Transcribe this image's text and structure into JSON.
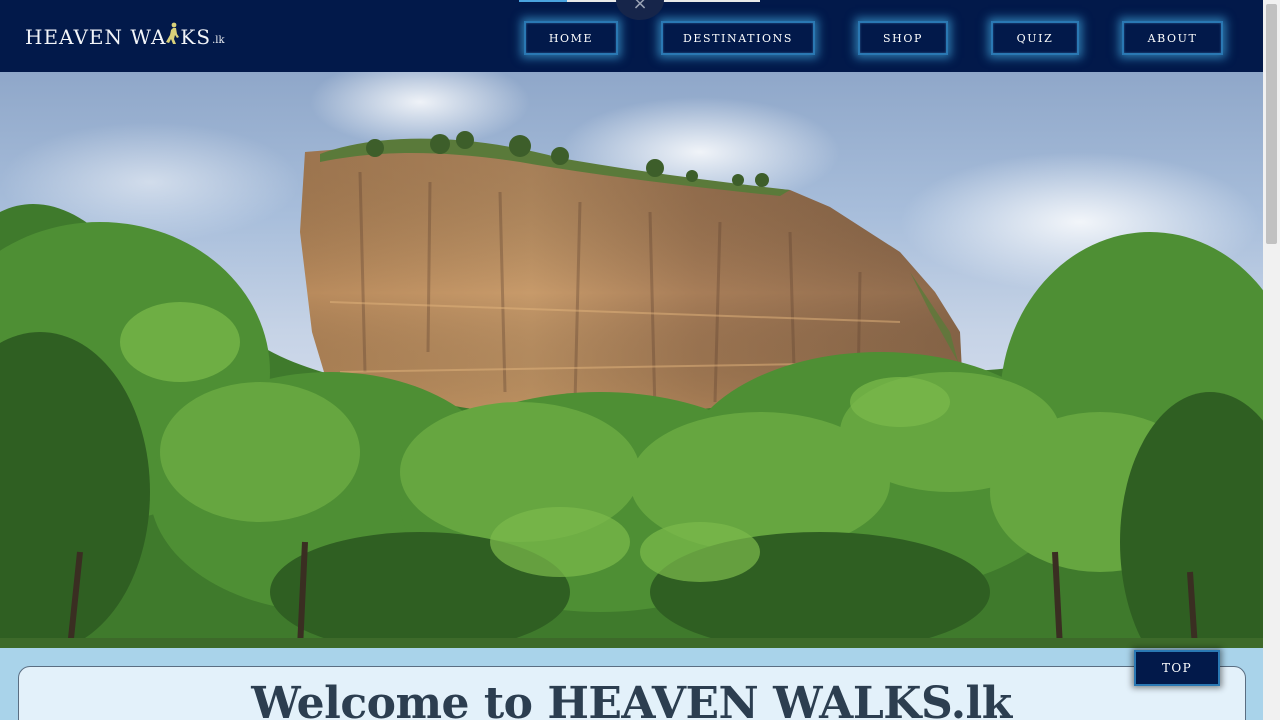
{
  "nav": {
    "logo_main": "HEAVEN WA",
    "logo_walker": "☘",
    "logo_rest": "KS",
    "logo_tld": ".lk",
    "items": [
      {
        "label": "HOME"
      },
      {
        "label": "DESTINATIONS"
      },
      {
        "label": "SHOP"
      },
      {
        "label": "QUIZ"
      },
      {
        "label": "ABOUT"
      }
    ]
  },
  "popup": {
    "close_symbol": "×"
  },
  "hero": {
    "icon": "sigiriya-rock-photo"
  },
  "welcome": {
    "title": "Welcome to HEAVEN WALKS.lk"
  },
  "top_button": {
    "label": "TOP"
  },
  "colors": {
    "nav_bg": "#02194a",
    "nav_glow": "#50c8ff",
    "page_bg": "#a9d3ea",
    "card_bg": "#e3f1fa",
    "title_text": "#2c3e50"
  }
}
